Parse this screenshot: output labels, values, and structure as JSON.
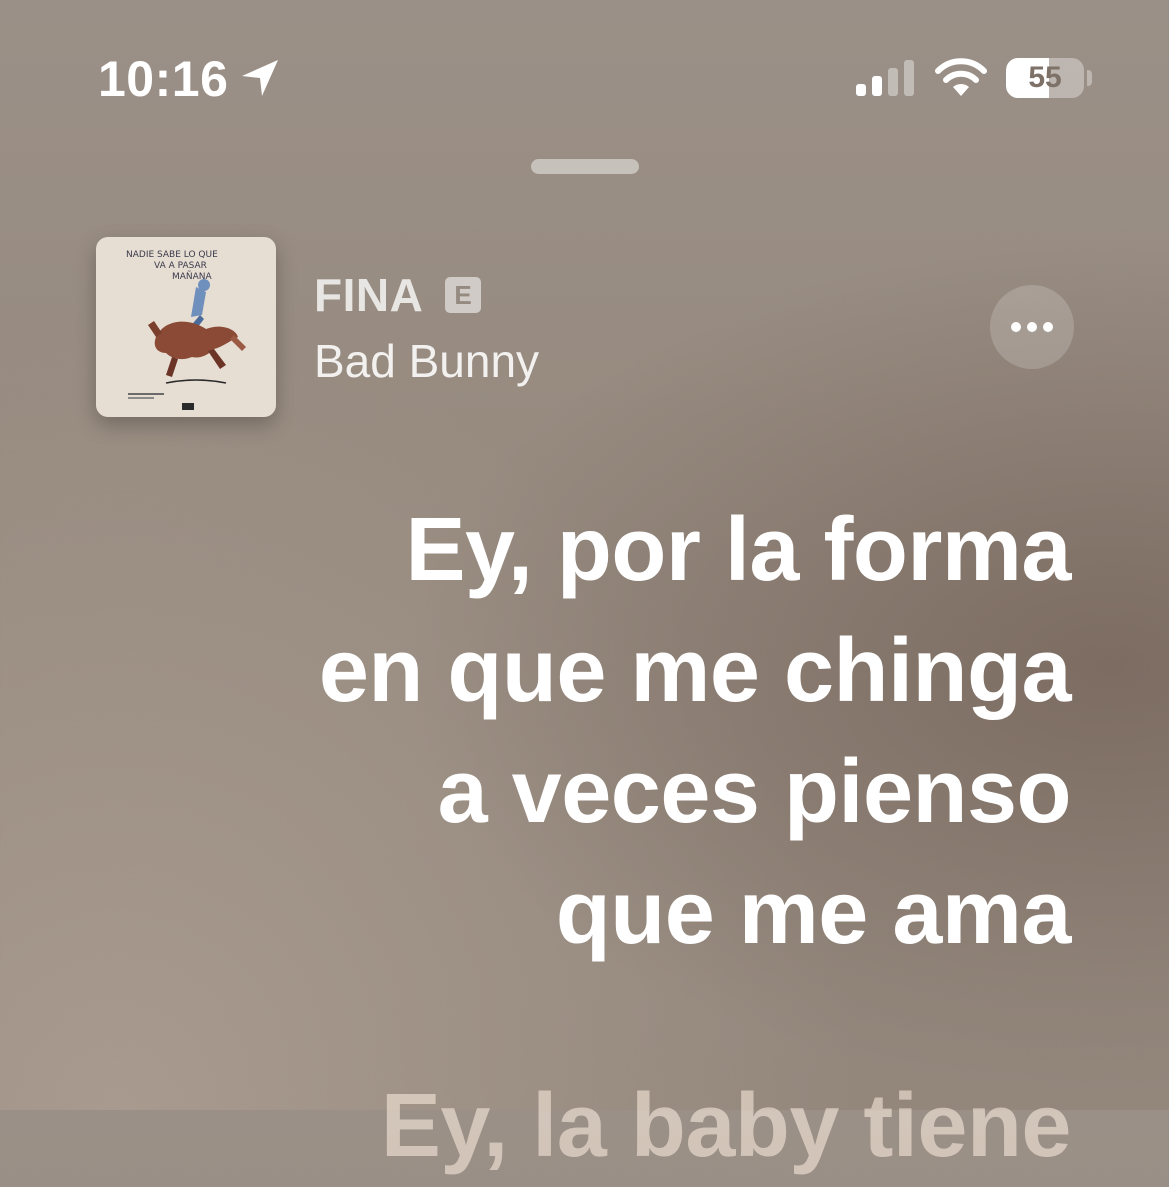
{
  "status_bar": {
    "time": "10:16",
    "location_icon": "location-arrow-icon",
    "signal_icon": "cellular-signal-icon",
    "wifi_icon": "wifi-icon",
    "battery_level": "55",
    "battery_fraction": 0.55
  },
  "now_playing": {
    "title": "FINA",
    "explicit_label": "E",
    "artist": "Bad Bunny",
    "artwork": {
      "text_line1": "NADIE SABE LO QUE",
      "text_line2": "VA A PASAR",
      "text_line3": "MAÑANA"
    },
    "more_icon": "ellipsis-icon"
  },
  "lyrics": {
    "current_lines": [
      "Ey, por la forma",
      "en que me chinga",
      "a veces pienso",
      "que me ama"
    ],
    "next_line": "Ey, la baby tiene"
  }
}
